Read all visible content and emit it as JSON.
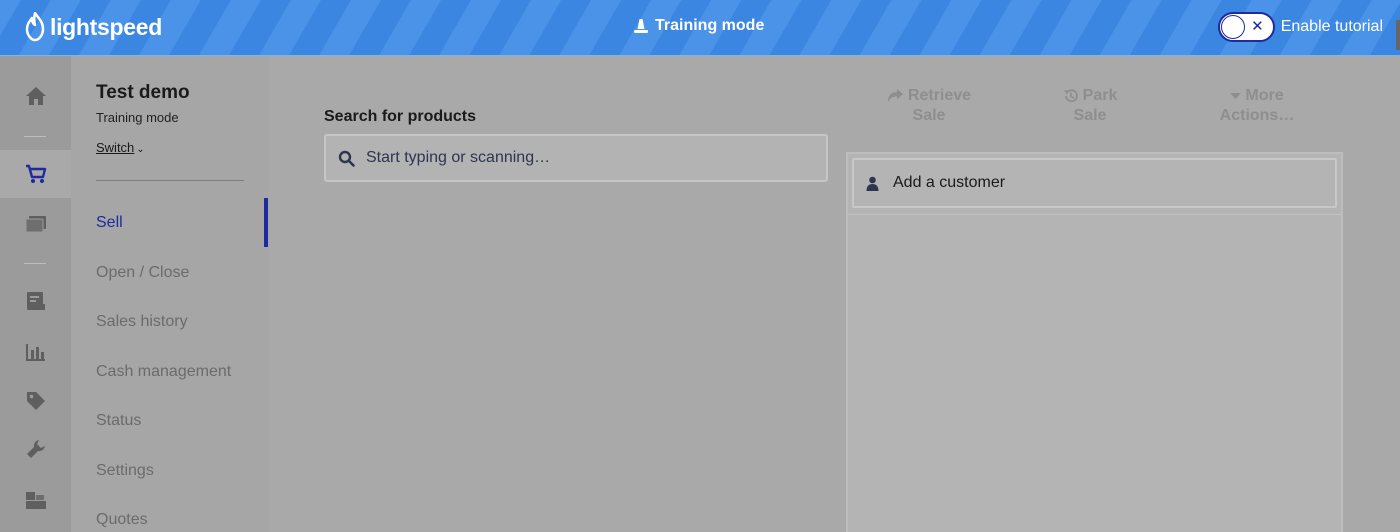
{
  "topbar": {
    "logo_text": "lightspeed",
    "mode_label": "Training mode",
    "tutorial_label": "Enable tutorial",
    "tutorial_enabled": false
  },
  "rail": {
    "items": [
      {
        "name": "home",
        "icon": "home-icon",
        "active": false
      },
      {
        "name": "sell",
        "icon": "cart-icon",
        "active": true
      },
      {
        "name": "sales",
        "icon": "register-icon",
        "active": false
      },
      {
        "name": "reports",
        "icon": "receipt-icon",
        "active": false
      },
      {
        "name": "analytics",
        "icon": "bar-chart-icon",
        "active": false
      },
      {
        "name": "catalog",
        "icon": "tag-icon",
        "active": false
      },
      {
        "name": "setup",
        "icon": "wrench-icon",
        "active": false
      },
      {
        "name": "inventory",
        "icon": "boxes-icon",
        "active": false
      }
    ]
  },
  "store": {
    "name": "Test demo",
    "mode": "Training mode",
    "switch_label": "Switch"
  },
  "subnav": {
    "items": [
      "Sell",
      "Open / Close",
      "Sales history",
      "Cash management",
      "Status",
      "Settings",
      "Quotes"
    ],
    "active": "Sell"
  },
  "search": {
    "label": "Search for products",
    "placeholder": "Start typing or scanning…"
  },
  "actions": [
    {
      "line1": "Retrieve",
      "line2": "Sale",
      "icon": "share-arrow-icon"
    },
    {
      "line1": "Park",
      "line2": "Sale",
      "icon": "history-icon"
    },
    {
      "line1": "More",
      "line2": "Actions…",
      "icon": "caret-down-icon"
    }
  ],
  "cart": {
    "customer_label": "Add a customer"
  },
  "colors": {
    "accent": "#1e2a9e",
    "topbar": "#3a86e0",
    "icon": "#2d3550"
  }
}
